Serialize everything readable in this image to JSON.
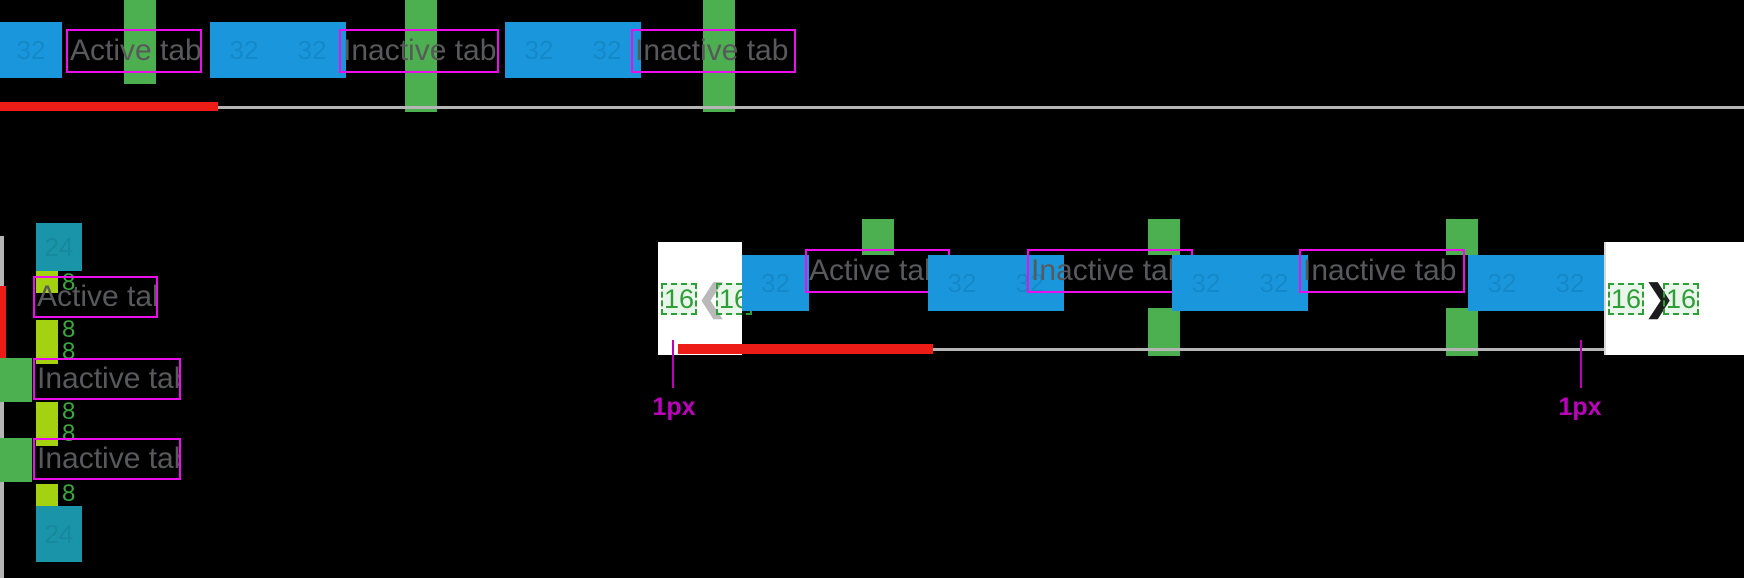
{
  "overlay": {
    "tool": "layout-inspector",
    "colors": {
      "padding_blue": "#1a97dc",
      "gap_green": "#4caf50",
      "gap_lime": "#a4d211",
      "padding_teal": "#1a94a8",
      "content_box_magenta": "#ec0fec",
      "measure_green": "#2e9e36",
      "indicator_red": "#ed1c16",
      "rule_grey": "#b5b5b5",
      "tick_magenta": "#ba00ba",
      "background": "#000000",
      "scroll_plate": "#ffffff"
    }
  },
  "top_tabbar": {
    "name": "horizontal-tab-bar-overflow",
    "tabs": [
      {
        "label": "Active tab",
        "state": "active",
        "pad_left": "32",
        "pad_right": "32"
      },
      {
        "label": "Inactive tab",
        "state": "inactive",
        "pad_left": "32",
        "pad_right": "32"
      },
      {
        "label": "Inactive tab",
        "state": "inactive",
        "pad_left": "32",
        "pad_right": "32"
      }
    ],
    "gaps": [
      "",
      "",
      ""
    ],
    "indicator": {
      "label": "active-indicator",
      "color": "#ed1c16"
    }
  },
  "side_tabbar": {
    "name": "vertical-tab-bar",
    "top_pad": "24",
    "bottom_pad": "24",
    "gap": "8",
    "tabs": [
      {
        "label": "Active tab",
        "state": "active"
      },
      {
        "label": "Inactive tab",
        "state": "inactive"
      },
      {
        "label": "Inactive tab",
        "state": "inactive"
      }
    ],
    "gap_labels": [
      "8",
      "8",
      "8",
      "8",
      "8",
      "8",
      "8"
    ]
  },
  "scrollable_tabbar": {
    "name": "horizontal-tab-bar-scrollable",
    "left_button": {
      "icon": "chevron-left-icon",
      "state": "disabled",
      "pad_left": "16",
      "pad_right": "16"
    },
    "right_button": {
      "icon": "chevron-right-icon",
      "state": "enabled",
      "pad_left": "16",
      "pad_right": "16"
    },
    "tabs": [
      {
        "label": "Active tab",
        "state": "active",
        "pad_left": "32",
        "pad_right": "32"
      },
      {
        "label": "Inactive tab",
        "state": "inactive",
        "pad_left": "32",
        "pad_right": "32"
      },
      {
        "label": "Inactive tab",
        "state": "inactive",
        "pad_left": "32",
        "pad_right": "32"
      }
    ],
    "border_callouts": [
      {
        "value": "1px",
        "side": "left"
      },
      {
        "value": "1px",
        "side": "right"
      }
    ],
    "indicator": {
      "label": "active-indicator",
      "color": "#ed1c16"
    }
  },
  "glyphs": {
    "chevron_left": "❮",
    "chevron_right": "❯"
  }
}
